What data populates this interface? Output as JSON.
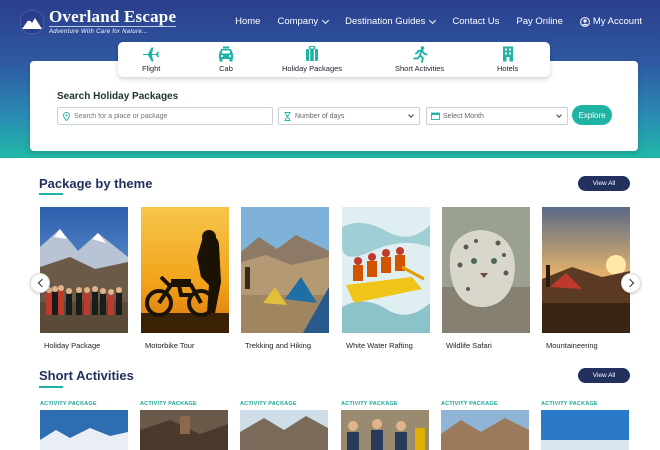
{
  "brand": {
    "name": "Overland Escape",
    "tagline": "Adventure With Care for Nature...",
    "colors": {
      "navy": "#23305e",
      "teal": "#1fb3a5"
    }
  },
  "nav": {
    "items": [
      {
        "label": "Home",
        "dropdown": false
      },
      {
        "label": "Company",
        "dropdown": true
      },
      {
        "label": "Destination Guides",
        "dropdown": true
      },
      {
        "label": "Contact Us",
        "dropdown": false
      },
      {
        "label": "Pay Online",
        "dropdown": false
      },
      {
        "label": "My Account",
        "icon": "user-icon"
      }
    ]
  },
  "tabs": [
    {
      "label": "Flight",
      "icon": "plane-icon"
    },
    {
      "label": "Cab",
      "icon": "car-icon"
    },
    {
      "label": "Holiday Packages",
      "icon": "suitcase-icon"
    },
    {
      "label": "Short Activities",
      "icon": "runner-icon"
    },
    {
      "label": "Hotels",
      "icon": "building-icon"
    }
  ],
  "search": {
    "title": "Search Holiday Packages",
    "place_placeholder": "Search for a place or package",
    "days_placeholder": "Number of days",
    "month_placeholder": "Select Month",
    "button": "Explore"
  },
  "themes": {
    "title": "Package by theme",
    "view_all": "View All",
    "cards": [
      {
        "label": "Holiday Package"
      },
      {
        "label": "Motorbike Tour"
      },
      {
        "label": "Trekking and Hiking"
      },
      {
        "label": "White Water Rafting"
      },
      {
        "label": "Wildlife Safari"
      },
      {
        "label": "Mountaineering"
      }
    ]
  },
  "activities": {
    "title": "Short Activities",
    "view_all": "View All",
    "tag": "ACTIVITY PACKAGE",
    "count_visible": 6
  }
}
